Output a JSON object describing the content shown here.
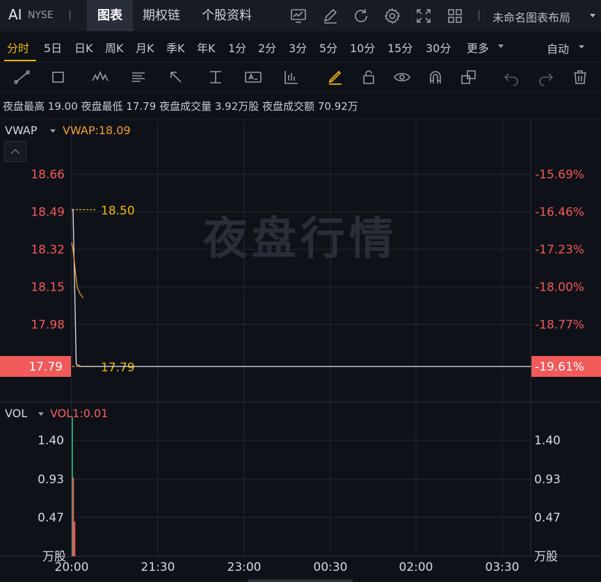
{
  "header": {
    "ticker": "AI",
    "exchange": "NYSE",
    "tabs": [
      {
        "label": "图表"
      },
      {
        "label": "期权链"
      },
      {
        "label": "个股资料"
      }
    ],
    "layout_name": "未命名图表布局"
  },
  "periods": [
    "分时",
    "5日",
    "日K",
    "周K",
    "月K",
    "季K",
    "年K",
    "1分",
    "2分",
    "3分",
    "5分",
    "10分",
    "15分",
    "30分",
    "更多"
  ],
  "period_active": "分时",
  "auto_label": "自动",
  "info": {
    "high_label": "夜盘最高",
    "high": "19.00",
    "low_label": "夜盘最低",
    "low": "17.79",
    "vol_label": "夜盘成交量",
    "vol": "3.92万股",
    "amt_label": "夜盘成交额",
    "amt": "70.92万"
  },
  "watermark": "夜盘行情",
  "colors": {
    "accent": "#f0b90b",
    "price_line": "#e8e8ea",
    "vwap_line": "#e8a030",
    "up": "#26a269",
    "down": "#f05a5a",
    "grid": "#252833"
  },
  "chart_data": [
    {
      "type": "line",
      "indicator": "VWAP",
      "indicator_value": "VWAP:18.09",
      "ylim": [
        17.79,
        18.75
      ],
      "y_ticks": [
        "18.66",
        "18.49",
        "18.32",
        "18.15",
        "17.98"
      ],
      "y_ticks_right": [
        "-15.69%",
        "-16.46%",
        "-17.23%",
        "-18.00%",
        "-18.77%"
      ],
      "current_price": "17.79",
      "current_pct": "-19.61%",
      "annotations": [
        {
          "label": "18.50",
          "y": 18.5
        },
        {
          "label": "17.79",
          "y": 17.79
        }
      ],
      "x_ticks": [
        "20:00",
        "21:30",
        "23:00",
        "00:30",
        "02:00",
        "03:30"
      ],
      "series": [
        {
          "name": "Price",
          "x": [
            0,
            0.003,
            0.01,
            0.02,
            0.05,
            0.1,
            1.0
          ],
          "values": [
            18.5,
            18.5,
            17.8,
            17.79,
            17.79,
            17.79,
            17.79
          ]
        },
        {
          "name": "VWAP",
          "x": [
            0,
            0.003,
            0.008,
            0.012,
            0.018,
            0.025
          ],
          "values": [
            18.35,
            18.32,
            18.22,
            18.15,
            18.12,
            18.1
          ]
        }
      ]
    },
    {
      "type": "bar",
      "indicator": "VOL",
      "indicator_value": "VOL1:0.01",
      "unit": "万股",
      "ylim": [
        0,
        1.68
      ],
      "y_ticks": [
        "1.40",
        "0.93",
        "0.47"
      ],
      "x_ticks": [
        "20:00",
        "21:30",
        "23:00",
        "00:30",
        "02:00",
        "03:30"
      ],
      "bars": [
        {
          "x": 0.0,
          "value": 1.68,
          "dir": "up"
        },
        {
          "x": 0.002,
          "value": 0.95,
          "dir": "down"
        },
        {
          "x": 0.005,
          "value": 0.42,
          "dir": "down"
        }
      ]
    }
  ]
}
